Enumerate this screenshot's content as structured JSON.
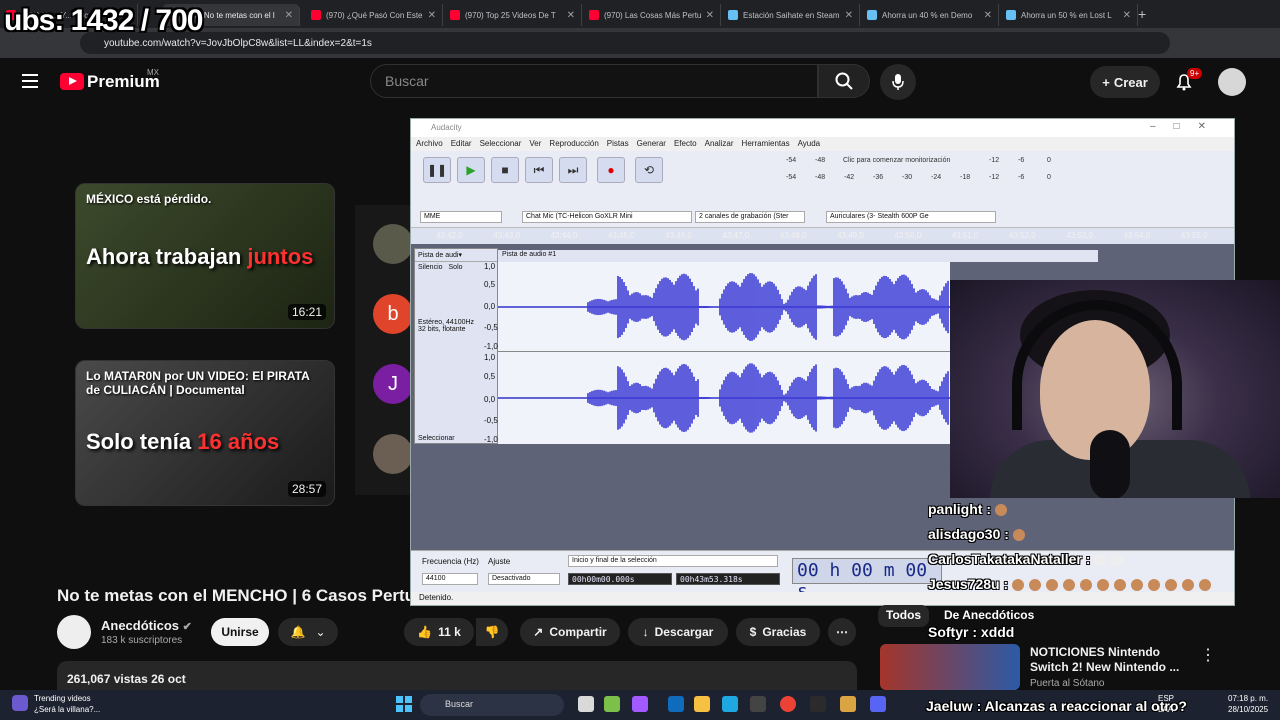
{
  "overlay": {
    "counter": "ubs: 1432 / 700"
  },
  "browser": {
    "tabs": [
      {
        "label": "(970) No... Y... Cuc..."
      },
      {
        "label": "(970) No te metas con el l",
        "active": true
      },
      {
        "label": "(970) ¿Qué Pasó Con Este"
      },
      {
        "label": "(970) Top 25 Videos De T"
      },
      {
        "label": "(970) Las Cosas Más Pertu"
      },
      {
        "label": "Estación Saihate en Steam"
      },
      {
        "label": "Ahorra un 40 % en Demo"
      },
      {
        "label": "Ahorra un 50 % en Lost L"
      }
    ],
    "url": "youtube.com/watch?v=JovJbOlpC8w&list=LL&index=2&t=1s"
  },
  "youtube": {
    "logo": "Premium",
    "region": "MX",
    "search_placeholder": "Buscar",
    "create_label": "Crear",
    "notif_count": "9+",
    "video_title": "No te metas con el MENCHO | 6 Casos Perturba",
    "channel_name": "Anecdóticos",
    "channel_subs": "183 k suscriptores",
    "subscribe_label": "Unirse",
    "likes": "11 k",
    "share_label": "Compartir",
    "download_label": "Descargar",
    "thanks_label": "Gracias",
    "views": "261,067 vistas  26 oct",
    "colors": {
      "red": "#ff0033",
      "bg": "#0f0f0f"
    }
  },
  "thumbnails": [
    {
      "top_text": "MÉXICO está pérdido.",
      "big_text": "Ahora trabajan ",
      "big_red": "juntos",
      "duration": "16:21"
    },
    {
      "top_text": "Lo MATAR0N por UN VIDEO: El PIRATA de CULIACÁN | Documental",
      "big_text": "Solo tenía ",
      "big_red": "16 años",
      "duration": "28:57"
    }
  ],
  "side_avatars": [
    {
      "letter": "",
      "color": "#5a5a4a"
    },
    {
      "letter": "b",
      "color": "#e0452b"
    },
    {
      "letter": "J",
      "color": "#7b1fa2"
    },
    {
      "letter": "",
      "color": "#6a5f52"
    }
  ],
  "audacity": {
    "title": "Audacity",
    "menu": [
      "Archivo",
      "Editar",
      "Seleccionar",
      "Ver",
      "Reproducción",
      "Pistas",
      "Generar",
      "Efecto",
      "Analizar",
      "Herramientas",
      "Ayuda"
    ],
    "meter_label": "Clic para comenzar monitorización",
    "meter_ticks": [
      "-54",
      "-48",
      "-42",
      "-36",
      "-30",
      "-24",
      "-18",
      "-12",
      "-6",
      "0"
    ],
    "host": "MME",
    "input_device": "Chat Mic (TC-Helicon GoXLR Mini",
    "channels": "2 canales de grabación (Ster",
    "output_device": "Auriculares (3- Stealth 600P Ge",
    "timeline": [
      "43:42,0",
      "43:43,0",
      "43:44,0",
      "43:45,0",
      "43:46,0",
      "43:47,0",
      "43:48,0",
      "43:49,0",
      "43:50,0",
      "43:51,0",
      "43:52,0",
      "43:53,0",
      "43:54,0",
      "43:55,0"
    ],
    "track_menu": "Pista de audi▾",
    "track_name": "Pista de audio #1",
    "mute": "Silencio",
    "solo": "Solo",
    "track_info": "Estéreo, 44100Hz\n32 bits, flotante",
    "select_label": "Seleccionar",
    "scale": [
      "1,0",
      "0,5",
      "0,0",
      "-0,5",
      "-1,0"
    ],
    "rate_label": "Frecuencia (Hz)",
    "snap_label": "Ajuste",
    "rate_value": "44100",
    "snap_value": "Desactivado",
    "sel_mode": "Inicio y final de la selección",
    "sel_start": "00h00m00.000s",
    "sel_end": "00h43m53.318s",
    "big_time": "00 h 00 m 00 s",
    "status": "Detenido."
  },
  "chat": [
    {
      "user": "panlight",
      "msg": ""
    },
    {
      "user": "alisdago30",
      "msg": ""
    },
    {
      "user": "CarlosTakatakaNataller",
      "msg": ""
    },
    {
      "user": "Jesus728u",
      "msg": ""
    },
    {
      "user": "Softyr",
      "msg": "xddd"
    },
    {
      "user": "Jaeluw",
      "msg": "Alcanzas a reaccionar al otro?"
    }
  ],
  "chips": [
    {
      "label": "Todos"
    },
    {
      "label": "De Anecdóticos"
    }
  ],
  "recommended": {
    "title": "NOTICIONES Nintendo Switch 2! New Nintendo ...",
    "sub": "Puerta al Sótano"
  },
  "taskbar": {
    "trend_title": "Trending videos",
    "trend_sub": "¿Será la villana?...",
    "search_placeholder": "Buscar",
    "lang": "ESP\nLAA",
    "time": "07:18 p. m.",
    "date": "28/10/2025"
  }
}
